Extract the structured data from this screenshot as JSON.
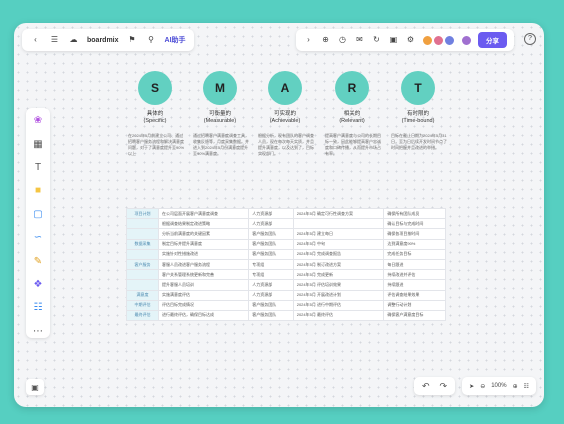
{
  "toolbar": {
    "brand": "boardmix",
    "ai_label": "AI助手",
    "share_label": "分享",
    "help": "?"
  },
  "smart": [
    {
      "letter": "S",
      "title_cn": "具体的",
      "title_en": "(Specific)",
      "desc": "在2024年5月前建立公司、通过招聘客户服务流程和解决满意度问题，对于了满意度提升至90%以上"
    },
    {
      "letter": "M",
      "title_cn": "可衡量的",
      "title_en": "(Measurable)",
      "desc": "通过招聘客户满意度调查工具，收集反馈等，月度采集数据。并进入到2024年5月份满意度提升至90%满意度。"
    },
    {
      "letter": "A",
      "title_cn": "可实现的",
      "title_en": "(Achievable)",
      "desc": "根据分析，现有团队的客户调查人员，现在每次每天实质，并且提升满意度，以及达到了，目标实现部门。"
    },
    {
      "letter": "R",
      "title_cn": "相关的",
      "title_en": "(Relevant)",
      "desc": "提高客户满意度与公司的长期目标一致，因此能够提高客户忠诚度和口碑传播，从而提升市场占有率。"
    },
    {
      "letter": "T",
      "title_cn": "有时限的",
      "title_en": "(Time-bound)",
      "desc": "目标在截止日期为2024年5月31日，至为日后续开发时间节点了时间把握并且改进的举措。"
    }
  ],
  "table": [
    [
      "项目计划",
      "在公司层面开展客户满意度调查",
      "人力资源部",
      "2024年5月 确定可行性调查方案",
      "确保所有团队成员"
    ],
    [
      "",
      "根据调查结果制定改进策略",
      "人力资源部",
      "",
      "确认目标与完成时间"
    ],
    [
      "",
      "分析当前满意度的关键因素",
      "客户服务团队",
      "2024年5月 建立每日",
      "确保各项目按时间"
    ],
    [
      "数据采集",
      "制定目标并提升满意度",
      "客户服务团队",
      "2024年5月 中旬",
      "达到满意度90%"
    ],
    [
      "",
      "实施针对性措施改进",
      "客户服务团队",
      "2024年5月 完成调查报告",
      "完成任务目标"
    ],
    [
      "客户服务",
      "客服人员改进客户服务流程",
      "专项组",
      "2024年5月 制订改进方案",
      "每日跟进"
    ],
    [
      "",
      "客户关系管理系统更新和完善",
      "专项组",
      "2024年5月 完成更新",
      "持续改进并评估"
    ],
    [
      "",
      "提升客服人员培训",
      "人力资源部",
      "2024年5月 评估培训效果",
      "持续跟进"
    ],
    [
      "满意度",
      "实施满意度评估",
      "人力资源部",
      "2024年5月 开展改进计划",
      "评估调查结果效果"
    ],
    [
      "中期评估",
      "评估目标完成情况",
      "客户服务团队",
      "2024年5月 进行中期评估",
      "调整行动计划"
    ],
    [
      "最终评估",
      "进行最终评估，确保目标达成",
      "客户服务团队",
      "2024年5月 最终评估",
      "确保客户满意度目标"
    ]
  ],
  "zoom": {
    "level": "100%"
  }
}
